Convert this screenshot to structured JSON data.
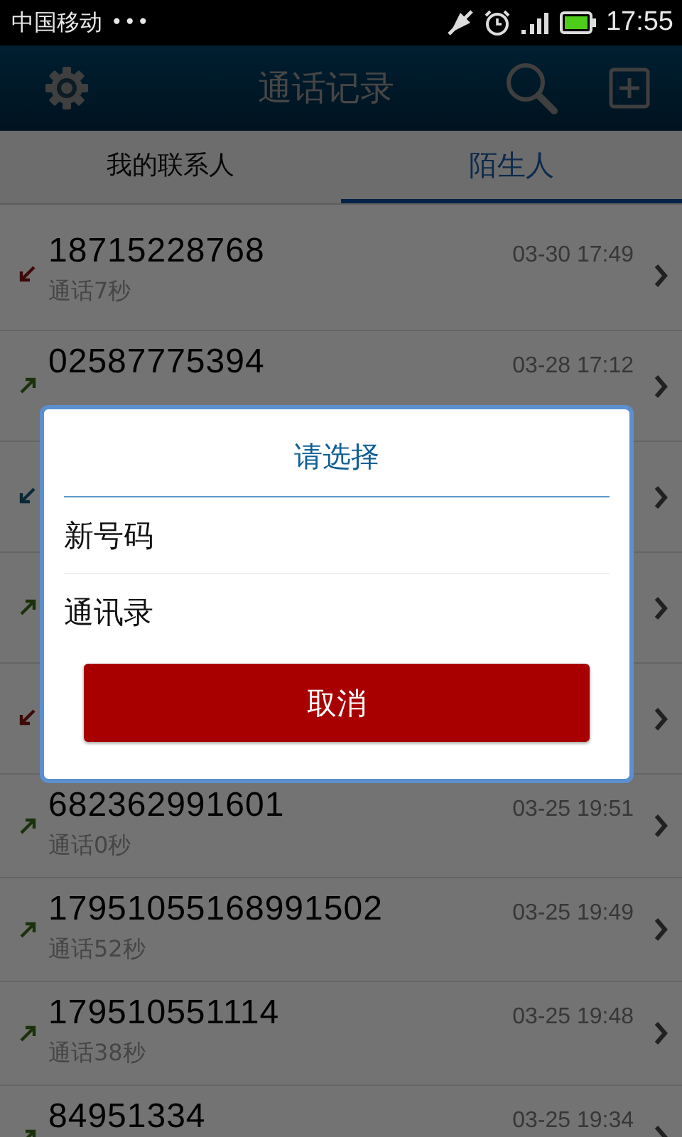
{
  "status_bar": {
    "carrier": "中国移动",
    "dots": "•••",
    "time": "17:55"
  },
  "header": {
    "title": "通话记录"
  },
  "tabs": [
    {
      "label": "我的联系人",
      "selected": false
    },
    {
      "label": "陌生人",
      "selected": true
    }
  ],
  "calls": [
    {
      "kind": "missed",
      "number": "18715228768",
      "time": "03-30 17:49",
      "duration": "通话7秒"
    },
    {
      "kind": "outgoing",
      "number": "02587775394",
      "time": "03-28 17:12"
    },
    {
      "kind": "incoming"
    },
    {
      "kind": "outgoing"
    },
    {
      "kind": "missed"
    },
    {
      "kind": "outgoing",
      "number": "682362991601",
      "time": "03-25 19:51",
      "duration": "通话0秒"
    },
    {
      "kind": "outgoing",
      "number": "17951055168991502",
      "time": "03-25 19:49",
      "duration": "通话52秒"
    },
    {
      "kind": "outgoing",
      "number": "179510551114",
      "time": "03-25 19:48",
      "duration": "通话38秒"
    },
    {
      "kind": "outgoing",
      "number": "84951334",
      "time": "03-25 19:34"
    }
  ],
  "dialog": {
    "title": "请选择",
    "options": [
      "新号码",
      "通讯录"
    ],
    "cancel": "取消"
  }
}
